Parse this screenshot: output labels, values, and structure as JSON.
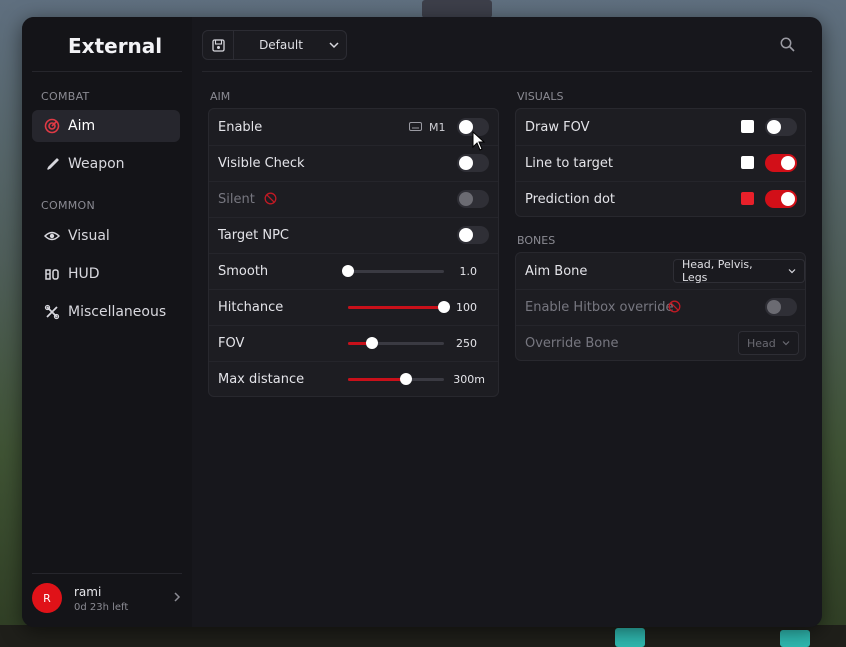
{
  "app": {
    "title": "External"
  },
  "sidebar": {
    "sections": [
      {
        "label": "COMBAT"
      },
      {
        "label": "COMMON"
      }
    ],
    "items": [
      {
        "label": "Aim",
        "icon": "target-icon",
        "active": true
      },
      {
        "label": "Weapon",
        "icon": "knife-icon",
        "active": false
      },
      {
        "label": "Visual",
        "icon": "eye-icon",
        "active": false
      },
      {
        "label": "HUD",
        "icon": "hud-icon",
        "active": false
      },
      {
        "label": "Miscellaneous",
        "icon": "tools-icon",
        "active": false
      }
    ]
  },
  "user": {
    "initial": "R",
    "name": "rami",
    "time_left": "0d 23h left"
  },
  "toolbar": {
    "config_name": "Default",
    "save_icon": "save-icon",
    "search_icon": "search-icon"
  },
  "aim": {
    "group_label": "AIM",
    "enable": {
      "label": "Enable",
      "key": "M1",
      "on": false
    },
    "visible_check": {
      "label": "Visible Check",
      "on": false
    },
    "silent": {
      "label": "Silent",
      "on": false,
      "disabled": true
    },
    "target_npc": {
      "label": "Target NPC",
      "on": false
    },
    "smooth": {
      "label": "Smooth",
      "value_text": "1.0",
      "fraction": 0.0
    },
    "hitchance": {
      "label": "Hitchance",
      "value_text": "100",
      "fraction": 1.0
    },
    "fov": {
      "label": "FOV",
      "value_text": "250",
      "fraction": 0.25
    },
    "max_distance": {
      "label": "Max distance",
      "value_text": "300m",
      "fraction": 0.6
    }
  },
  "visuals": {
    "group_label": "VISUALS",
    "draw_fov": {
      "label": "Draw FOV",
      "color": "#ffffff",
      "on": false
    },
    "line_to_target": {
      "label": "Line to target",
      "color": "#ffffff",
      "on": true
    },
    "prediction_dot": {
      "label": "Prediction dot",
      "color": "#e8202a",
      "on": true
    }
  },
  "bones": {
    "group_label": "BONES",
    "aim_bone": {
      "label": "Aim Bone",
      "value": "Head, Pelvis, Legs"
    },
    "hitbox_override": {
      "label": "Enable Hitbox override",
      "on": false,
      "disabled": true
    },
    "override_bone": {
      "label": "Override Bone",
      "value": "Head",
      "disabled": true
    }
  },
  "colors": {
    "accent": "#d20f18",
    "background": "#17171c",
    "card": "#1d1d22"
  }
}
